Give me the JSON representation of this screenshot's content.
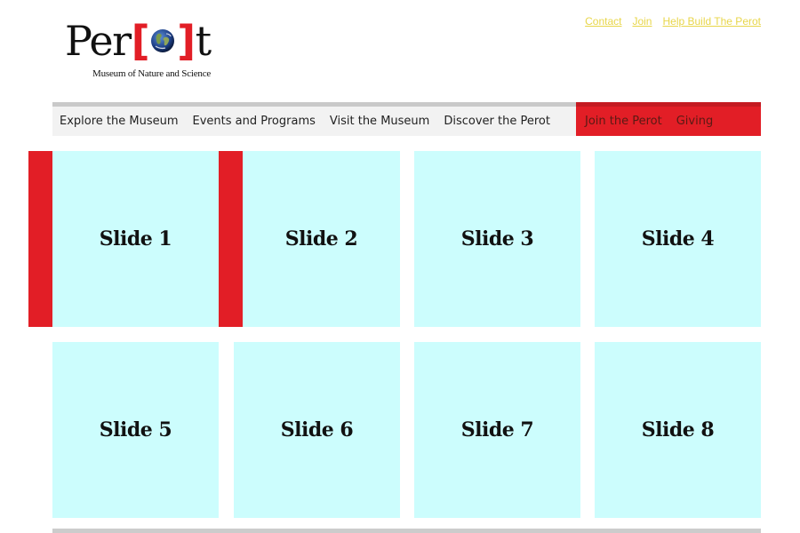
{
  "logo": {
    "word_start": "Per",
    "bracket_open": "[",
    "bracket_close": "]",
    "word_end": "t",
    "tagline": "Museum of Nature and Science",
    "icon": "globe-icon"
  },
  "util_links": [
    {
      "label": "Contact"
    },
    {
      "label": "Join"
    },
    {
      "label": "Help Build The Perot"
    }
  ],
  "nav": {
    "main_items": [
      {
        "label": "Explore the Museum"
      },
      {
        "label": "Events and Programs"
      },
      {
        "label": "Visit the Museum"
      },
      {
        "label": "Discover the Perot"
      }
    ],
    "side_items": [
      {
        "label": "Join the Perot"
      },
      {
        "label": "Giving"
      }
    ]
  },
  "slides": [
    {
      "label": "Slide 1"
    },
    {
      "label": "Slide 2"
    },
    {
      "label": "Slide 3"
    },
    {
      "label": "Slide 4"
    },
    {
      "label": "Slide 5"
    },
    {
      "label": "Slide 6"
    },
    {
      "label": "Slide 7"
    },
    {
      "label": "Slide 8"
    }
  ],
  "colors": {
    "brand_red": "#e21e26",
    "slide_bg": "#ccfdfd",
    "link_yellow": "#e8d64a",
    "nav_bg": "#f2f2f2"
  }
}
